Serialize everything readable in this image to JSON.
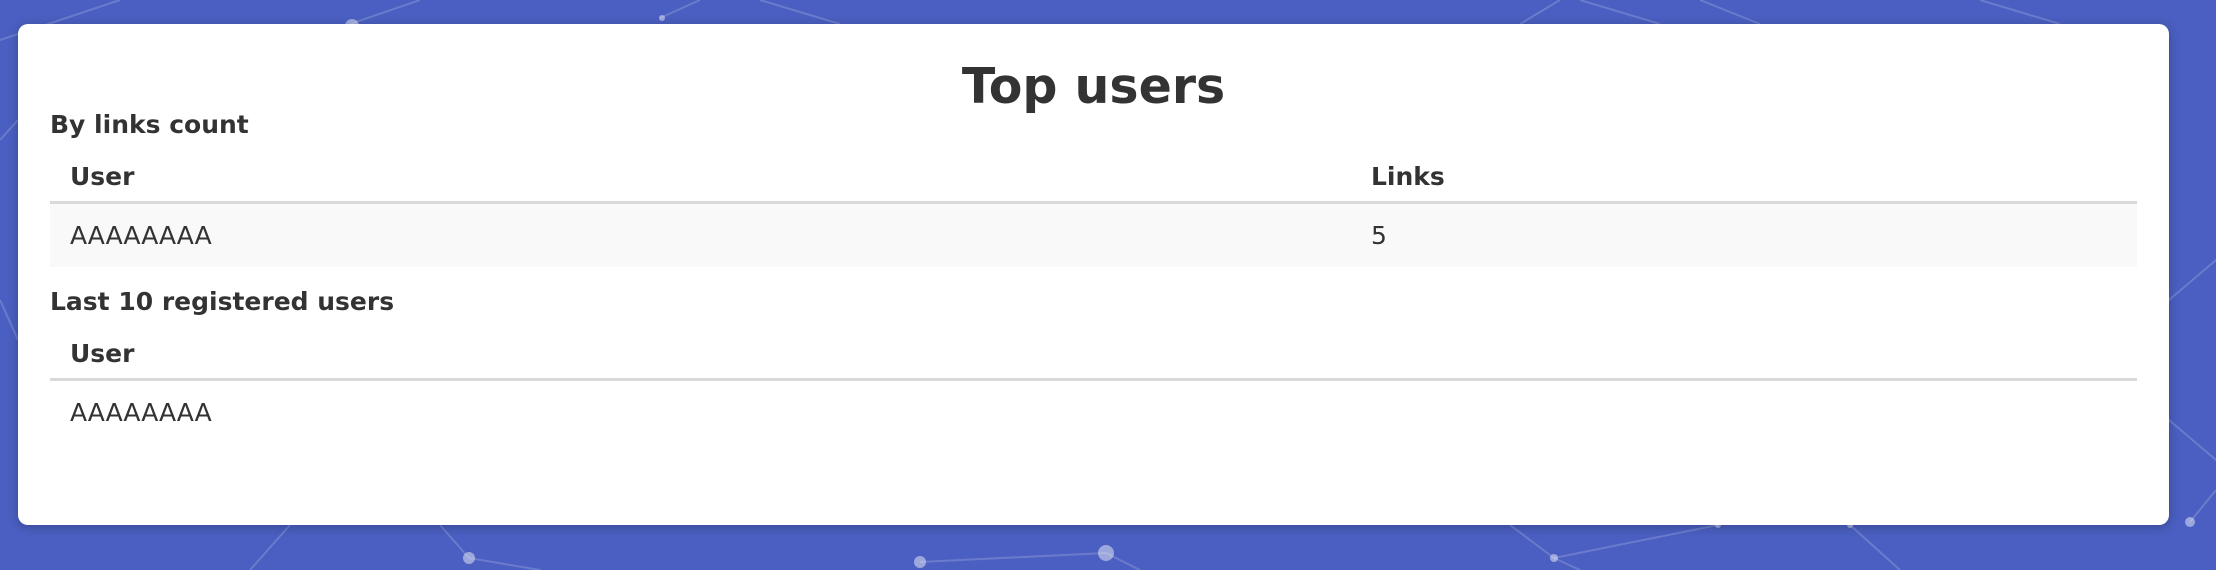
{
  "page_title": "Top users",
  "by_links": {
    "title": "By links count",
    "columns": [
      "User",
      "Links"
    ],
    "rows": [
      {
        "user": "AAAAAAAA",
        "links": "5"
      }
    ]
  },
  "last_registered": {
    "title": "Last 10 registered users",
    "columns": [
      "User"
    ],
    "rows": [
      {
        "user": "AAAAAAAA"
      }
    ]
  },
  "colors": {
    "background": "#4a5fc1",
    "card": "#ffffff",
    "text": "#333333",
    "row_stripe": "#f9f9f9",
    "divider": "#d9d9d9"
  }
}
